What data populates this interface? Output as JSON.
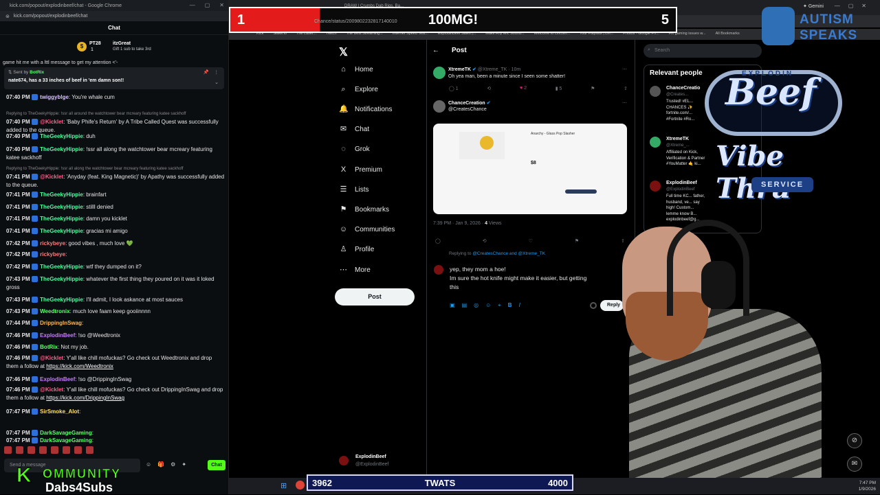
{
  "chat_window": {
    "title": "kick.com/popout/explodinbeef/chat - Google Chrome",
    "url": "kick.com/popout/explodinbeef/chat",
    "header": "Chat",
    "gifter": {
      "rank": "PT28",
      "count": "1",
      "name": "itzGreat",
      "sub": "Gift 1 sub to take 3rd"
    },
    "pinned": {
      "sent_by": "Sent by",
      "sender": "BotRix",
      "text": "nate674, has a 33 inches of beef in 'em damn son!!"
    },
    "partial_top_text": "game hit me with a lttl message to get my attention <'-",
    "messages": [
      {
        "time": "07:40 PM",
        "user": "twiggyblge",
        "color": "#d9c6ff",
        "text": ": You're whale cum"
      },
      {
        "reply": "Replying to TheGeekyHippie: !ssr all around the watchtower bear mcreary featuring katee sackhoff",
        "time": "07:40 PM",
        "user": "@Kicklet",
        "color": "#ff5f8a",
        "text": ": 'Baby Phife's Return' by A Tribe Called Quest was successfully added to the queue."
      },
      {
        "time": "07:40 PM",
        "user": "TheGeekyHippie",
        "color": "#4dfd9f",
        "text": ": duh"
      },
      {
        "time": "07:40 PM",
        "user": "TheGeekyHippie",
        "color": "#4dfd9f",
        "text": ": !ssr all along the watchtower bear mcreary featuring katee sackhoff"
      },
      {
        "reply": "Replying to TheGeekyHippie: !ssr all along the watchtower bear mcreary featuring katee sackhoff",
        "time": "07:41 PM",
        "user": "@Kicklet",
        "color": "#ff5f8a",
        "text": ": 'Anyday (feat. King Magnetic)' by Apathy was successfully added to the queue."
      },
      {
        "time": "07:41 PM",
        "user": "TheGeekyHippie",
        "color": "#4dfd9f",
        "text": ": brainfart"
      },
      {
        "time": "07:41 PM",
        "user": "TheGeekyHippie",
        "color": "#4dfd9f",
        "text": ": stilll denied"
      },
      {
        "time": "07:41 PM",
        "user": "TheGeekyHippie",
        "color": "#4dfd9f",
        "text": ": damn you kicklet"
      },
      {
        "time": "07:41 PM",
        "user": "TheGeekyHippie",
        "color": "#4dfd9f",
        "text": ": gracias mi amigo"
      },
      {
        "time": "07:42 PM",
        "user": "rickybeye",
        "color": "#ff7a7a",
        "text": ": good vibes , much love 💚"
      },
      {
        "time": "07:42 PM",
        "user": "rickybeye",
        "color": "#ff7a7a",
        "text": ":"
      },
      {
        "time": "07:42 PM",
        "user": "TheGeekyHippie",
        "color": "#4dfd9f",
        "text": ": wtf they dumped on it?"
      },
      {
        "time": "07:43 PM",
        "user": "TheGeekyHippie",
        "color": "#4dfd9f",
        "text": ": whatever the first thing they poured on it was it loked gross"
      },
      {
        "time": "07:43 PM",
        "user": "TheGeekyHippie",
        "color": "#4dfd9f",
        "text": ": I'll admit, I look askance at most sauces"
      },
      {
        "time": "07:43 PM",
        "user": "Weedtronix",
        "color": "#5cff6e",
        "text": ": much love faam keep gooiinnnn"
      },
      {
        "time": "07:44 PM",
        "user": "DrippingInSwag",
        "color": "#ffb84d",
        "text": ":"
      },
      {
        "time": "07:46 PM",
        "user": "ExplodinBeef",
        "color": "#c77dff",
        "text": ": !so @Weedtronix"
      },
      {
        "time": "07:46 PM",
        "user": "BotRix",
        "color": "#5cff6e",
        "text": ": Not my job."
      },
      {
        "time": "07:46 PM",
        "user": "@Kicklet",
        "color": "#ff5f8a",
        "text": ": Y'all like chill mofuckas? Go check out Weedtronix and drop them a follow at ",
        "link": "https://kick.com/Weedtronix"
      },
      {
        "time": "07:46 PM",
        "user": "ExplodinBeef",
        "color": "#c77dff",
        "text": ": !so @DrippingInSwag"
      },
      {
        "time": "07:46 PM",
        "user": "@Kicklet",
        "color": "#ff5f8a",
        "text": ": Y'all like chill mofuckas? Go check out DrippingInSwag and drop them a follow at ",
        "link": "https://kick.com/DrippingInSwag"
      },
      {
        "time": "07:47 PM",
        "user": "SirSmoke_Alot",
        "color": "#ffe066",
        "text": ":"
      },
      {
        "time": "07:47 PM",
        "user": "DarkSavageGaming",
        "color": "#5cff6e",
        "text": ":"
      },
      {
        "time": "07:47 PM",
        "user": "DarkSavageGaming",
        "color": "#5cff6e",
        "text": ":"
      }
    ],
    "input_placeholder": "Send a message",
    "chat_button": "Chat"
  },
  "counter": {
    "left": "1",
    "title": "100MG!",
    "right": "5",
    "progress_fraction": 0.2,
    "url_fragment": "Chance/status/2009802232817140010"
  },
  "twats_bar": {
    "left": "3962",
    "label": "TWATS",
    "right": "4000"
  },
  "browser": {
    "tab_label": "DRAW | Crumbs Dab Rigs, Ba...",
    "gemini": "Gemini",
    "bookmarks": [
      "Kick",
      "Slake.io",
      "The Laser...",
      "Twitch",
      "The Best Streaming...",
      "Internet Speed Test...",
      "ExplodinBeef Sales |...",
      "Make Any Mic Sound...",
      "Welcome to Lincoln...",
      "Your Playlists | Lin...",
      "Photos - Google Ph...",
      "Fix gaming issues w...",
      "All Bookmarks"
    ]
  },
  "x_nav": {
    "items": [
      {
        "label": "Home",
        "icon": "⌂"
      },
      {
        "label": "Explore",
        "icon": "⌕"
      },
      {
        "label": "Notifications",
        "icon": "🔔"
      },
      {
        "label": "Chat",
        "icon": "✉"
      },
      {
        "label": "Grok",
        "icon": "◌"
      },
      {
        "label": "Premium",
        "icon": "X"
      },
      {
        "label": "Lists",
        "icon": "☰"
      },
      {
        "label": "Bookmarks",
        "icon": "⚑"
      },
      {
        "label": "Communities",
        "icon": "☺"
      },
      {
        "label": "Profile",
        "icon": "♙"
      },
      {
        "label": "More",
        "icon": "⋯"
      }
    ],
    "post_button": "Post",
    "account": {
      "name": "ExplodinBeef",
      "handle": "@ExplodinBeef"
    }
  },
  "post": {
    "header": "Post",
    "tweet1": {
      "name": "XtremeTK",
      "handle": "@Xtreme_TK · 10m",
      "text": "Oh yea man, been a minute since I seen some shatter!",
      "replies": "1",
      "likes": "2",
      "views": "5"
    },
    "tweet2": {
      "name": "ChanceCreation",
      "handle": "@CreatesChance",
      "price": "$8",
      "product_title": "Anarchy - Glass Pop Slasher"
    },
    "meta_time": "7:39 PM · Jan 9, 2026 · ",
    "meta_views": "4",
    "meta_views_label": " Views",
    "reply_to": "Replying to ",
    "reply_to_handles": "@CreatesChance and @Xtreme_TK",
    "compose_lines": [
      "yep, they mom a hoe!",
      "Im sure the hot knife might make it easier, but getting",
      "this"
    ],
    "reply_button": "Reply"
  },
  "sidebar": {
    "search_placeholder": "Search",
    "relevant_header": "Relevant people",
    "people": [
      {
        "name": "ChanceCreatio",
        "handle": "@Creates...",
        "bio": "Trusted! #EL... CHANCES ✨ fortnite.com/... #Fortnite #Ro...",
        "color": "#555"
      },
      {
        "name": "XtremeTK",
        "handle": "@Xtreme_...",
        "bio": "Affiliated on Kick, Verification & Partner #YouMatter 🤙 ki...",
        "color": "#3a6"
      },
      {
        "name": "ExplodinBeef",
        "handle": "@ExplodinBeef",
        "bio": "Full time KC... father, husband, ve... say high! Custom... lemme know B... explodinbeef@g...",
        "color": "#7a1010"
      }
    ]
  },
  "overlays": {
    "autism": {
      "line1": "AUTISM",
      "line2": "SPEAKS"
    },
    "beef_sign": {
      "top": "EXPLODIN",
      "main": "Beef",
      "sub": "Vibe Thru",
      "service": "SERVICE"
    },
    "kommunity": {
      "k": "K",
      "line1": "OMMUNITY",
      "line2": "Dabs4Subs"
    }
  },
  "tray": {
    "time": "7:47 PM",
    "date": "1/9/2026"
  }
}
